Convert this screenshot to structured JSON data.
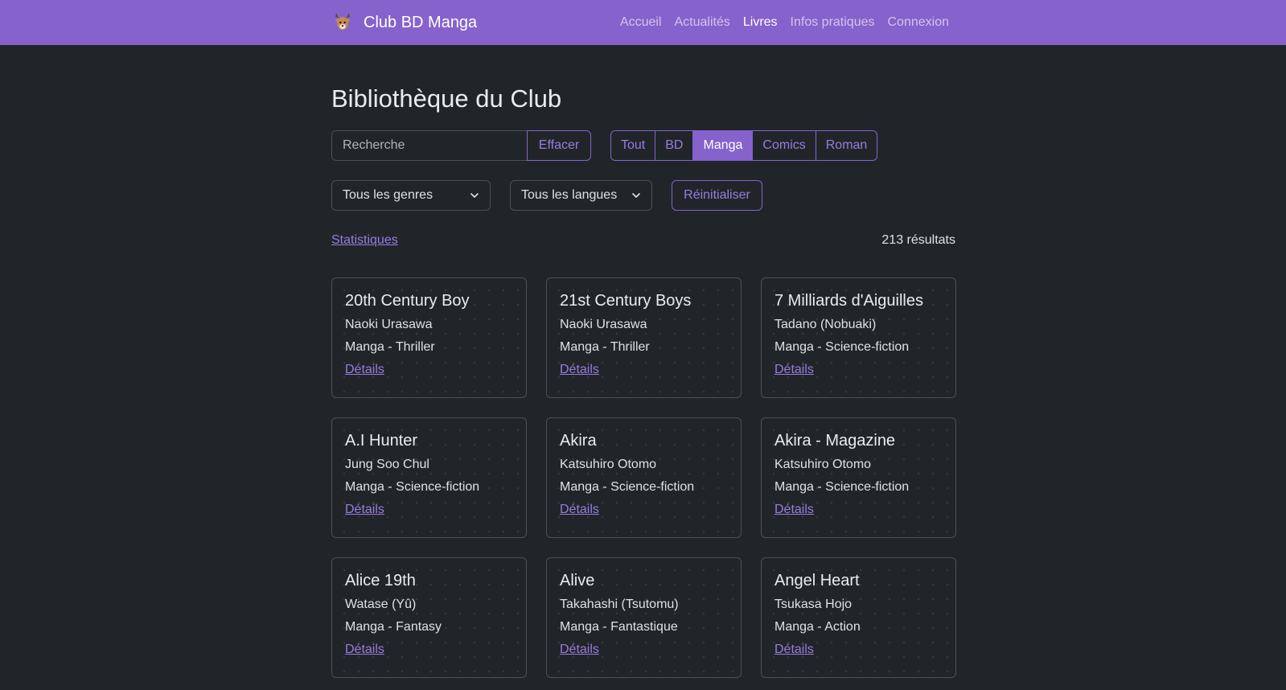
{
  "nav": {
    "brand": "Club BD Manga",
    "logo_icon": "deer-mascot-icon",
    "links": [
      "Accueil",
      "Actualités",
      "Livres",
      "Infos pratiques",
      "Connexion"
    ],
    "active": "Livres"
  },
  "page": {
    "title": "Bibliothèque du Club"
  },
  "search": {
    "placeholder": "Recherche",
    "value": "",
    "clear_label": "Effacer"
  },
  "categories": {
    "items": [
      "Tout",
      "BD",
      "Manga",
      "Comics",
      "Roman"
    ],
    "selected": "Manga"
  },
  "filters": {
    "genre": "Tous les genres",
    "language": "Tous les langues",
    "reset_label": "Réinitialiser"
  },
  "summary": {
    "stats_link": "Statistiques",
    "results": "213 résultats"
  },
  "books": [
    {
      "title": "20th Century Boy",
      "author": "Naoki Urasawa",
      "category": "Manga - Thriller",
      "link": "Détails"
    },
    {
      "title": "21st Century Boys",
      "author": "Naoki Urasawa",
      "category": "Manga - Thriller",
      "link": "Détails"
    },
    {
      "title": "7 Milliards d'Aiguilles",
      "author": "Tadano (Nobuaki)",
      "category": "Manga - Science-fiction",
      "link": "Détails"
    },
    {
      "title": "A.I Hunter",
      "author": "Jung Soo Chul",
      "category": "Manga - Science-fiction",
      "link": "Détails"
    },
    {
      "title": "Akira",
      "author": "Katsuhiro Otomo",
      "category": "Manga - Science-fiction",
      "link": "Détails"
    },
    {
      "title": "Akira - Magazine",
      "author": "Katsuhiro Otomo",
      "category": "Manga - Science-fiction",
      "link": "Détails"
    },
    {
      "title": "Alice 19th",
      "author": "Watase (Yû)",
      "category": "Manga - Fantasy",
      "link": "Détails"
    },
    {
      "title": "Alive",
      "author": "Takahashi (Tsutomu)",
      "category": "Manga - Fantastique",
      "link": "Détails"
    },
    {
      "title": "Angel Heart",
      "author": "Tsukasa Hojo",
      "category": "Manga - Action",
      "link": "Détails"
    }
  ],
  "colors": {
    "accent": "#8662cc",
    "link": "#9b7be0",
    "background": "#212529"
  }
}
